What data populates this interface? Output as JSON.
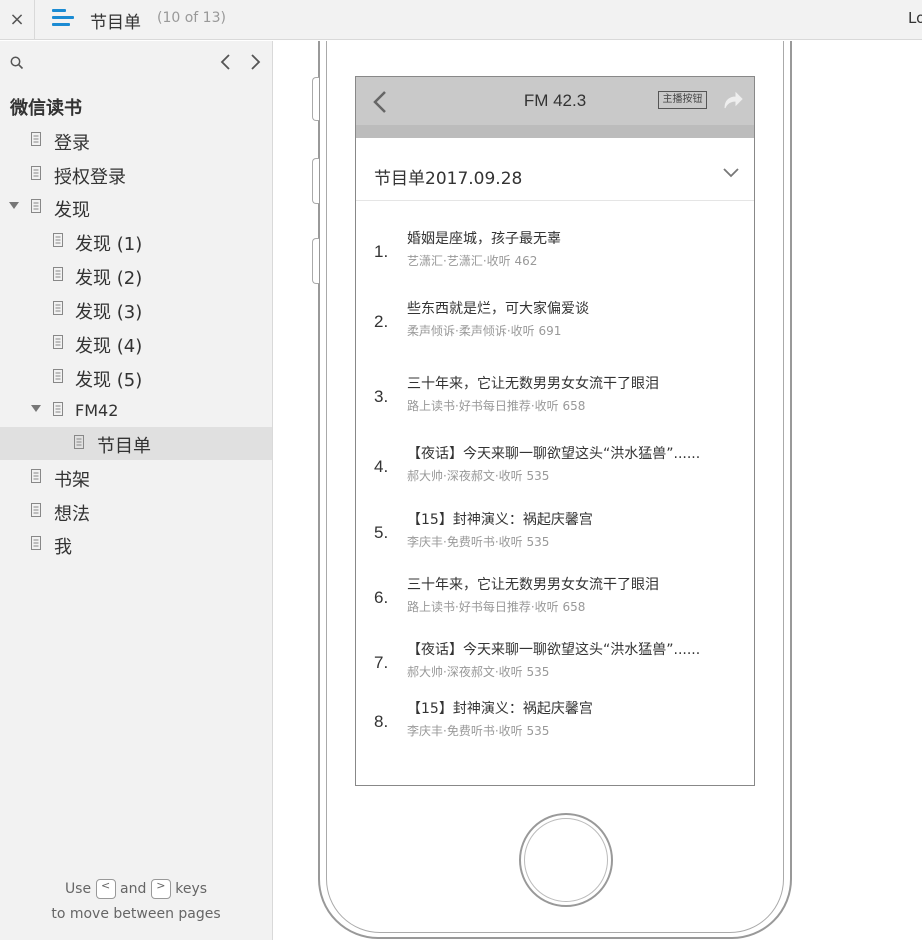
{
  "topbar": {
    "close": "×",
    "title": "节目单",
    "count": "(10 of 13)",
    "right": "Lo"
  },
  "sidebar": {
    "root": "微信读书",
    "items": [
      {
        "label": "登录"
      },
      {
        "label": "授权登录"
      },
      {
        "label": "发现"
      },
      {
        "label": "发现 (1)"
      },
      {
        "label": "发现 (2)"
      },
      {
        "label": "发现 (3)"
      },
      {
        "label": "发现 (4)"
      },
      {
        "label": "发现 (5)"
      },
      {
        "label": "FM42"
      },
      {
        "label": "节目单"
      },
      {
        "label": "书架"
      },
      {
        "label": "想法"
      },
      {
        "label": "我"
      }
    ],
    "hint": {
      "use": "Use",
      "key_prev": "<",
      "and": "and",
      "key_next": ">",
      "keys": "keys",
      "line2": "to move between pages"
    }
  },
  "phone": {
    "nav_title": "FM 42.3",
    "host_button": "主播按钮",
    "date_label": "节目单2017.09.28",
    "programs": [
      {
        "num": "1.",
        "title": "婚姻是座城，孩子最无辜",
        "meta": "艺潇汇·艺潇汇·收听 462"
      },
      {
        "num": "2.",
        "title": "些东西就是烂，可大家偏爱谈",
        "meta": "柔声倾诉·柔声倾诉·收听 691"
      },
      {
        "num": "3.",
        "title": "三十年来，它让无数男男女女流干了眼泪",
        "meta": "路上读书·好书每日推荐·收听 658"
      },
      {
        "num": "4.",
        "title": "【夜话】今天来聊一聊欲望这头“洪水猛兽”......",
        "meta": "郝大帅·深夜郝文·收听 535"
      },
      {
        "num": "5.",
        "title": "【15】封神演义：祸起庆馨宫",
        "meta": "李庆丰·免费听书·收听 535"
      },
      {
        "num": "6.",
        "title": "三十年来，它让无数男男女女流干了眼泪",
        "meta": "路上读书·好书每日推荐·收听 658"
      },
      {
        "num": "7.",
        "title": "【夜话】今天来聊一聊欲望这头“洪水猛兽”......",
        "meta": "郝大帅·深夜郝文·收听 535"
      },
      {
        "num": "8.",
        "title": "【15】封神演义：祸起庆馨宫",
        "meta": "李庆丰·免费听书·收听 535"
      }
    ]
  }
}
